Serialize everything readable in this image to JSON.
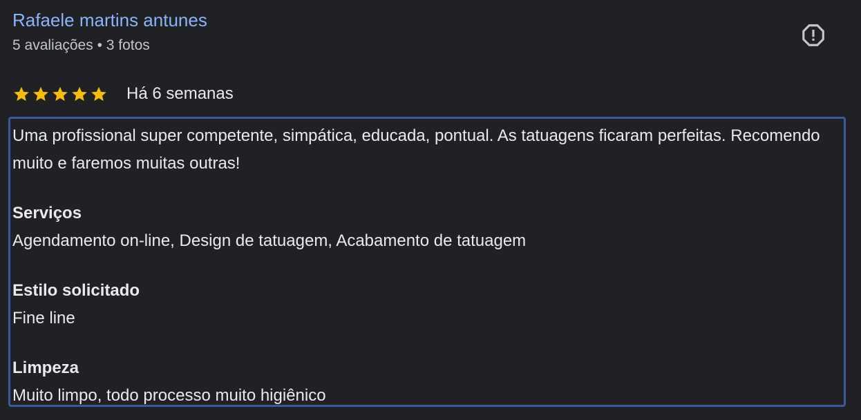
{
  "author": {
    "name": "Rafaele martins antunes",
    "meta": "5 avaliações • 3 fotos"
  },
  "rating": {
    "stars": 5,
    "date": "Há 6 semanas"
  },
  "review": {
    "text": "Uma profissional super competente, simpática, educada, pontual. As tatuagens ficaram perfeitas. Recomendo muito e faremos muitas outras!"
  },
  "sections": [
    {
      "title": "Serviços",
      "value": "Agendamento on-line, Design de tatuagem, Acabamento de tatuagem"
    },
    {
      "title": "Estilo solicitado",
      "value": "Fine line"
    },
    {
      "title": "Limpeza",
      "value": "Muito limpo, todo processo muito higiênico"
    }
  ],
  "icons": {
    "flag": "report-flag-icon",
    "star": "star-icon"
  },
  "colors": {
    "background": "#202124",
    "author": "#8ab4f8",
    "star": "#fbbc04",
    "focus_border": "#3b5a9a"
  }
}
